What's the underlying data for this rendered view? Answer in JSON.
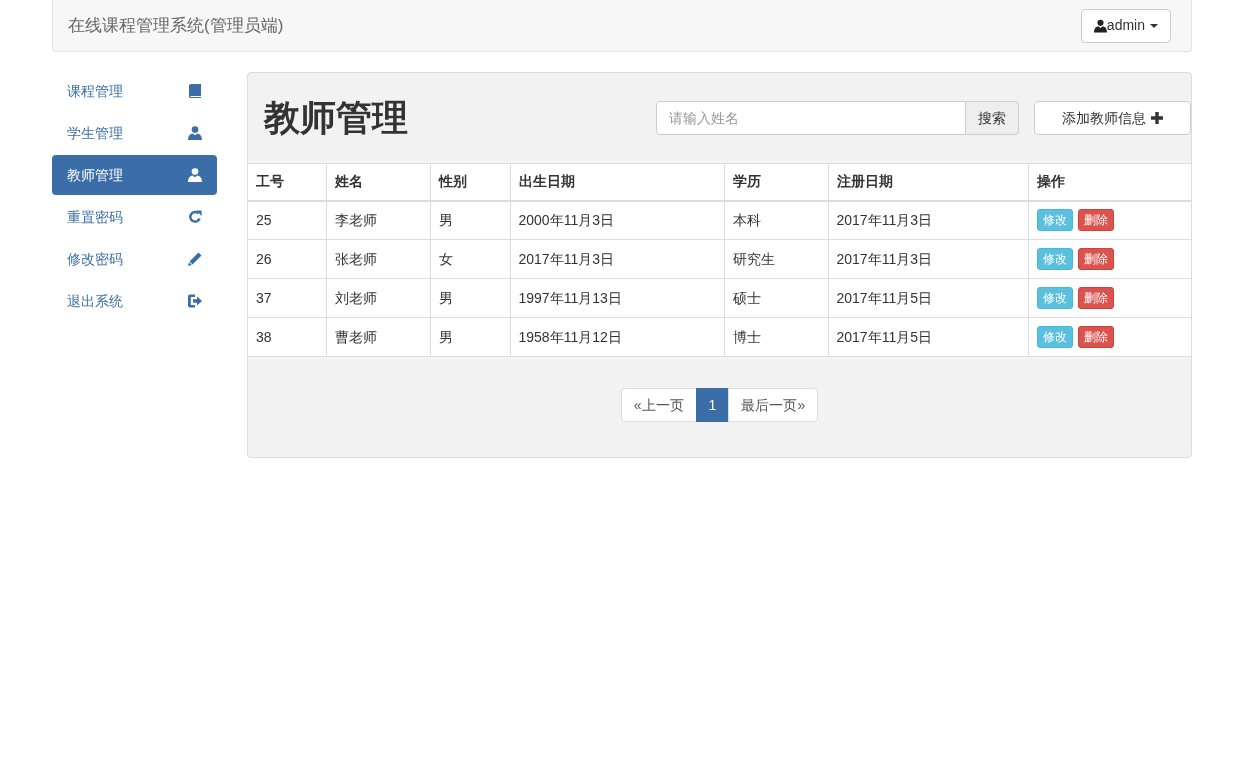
{
  "navbar": {
    "title": "在线课程管理系统(管理员端)",
    "user_menu": "admin"
  },
  "sidebar": {
    "items": [
      {
        "label": "课程管理",
        "selected": false
      },
      {
        "label": "学生管理",
        "selected": false
      },
      {
        "label": "教师管理",
        "selected": true
      },
      {
        "label": "重置密码",
        "selected": false
      },
      {
        "label": "修改密码",
        "selected": false
      },
      {
        "label": "退出系统",
        "selected": false
      }
    ]
  },
  "main": {
    "page_title": "教师管理",
    "search": {
      "placeholder": "请输入姓名",
      "button": "搜索"
    },
    "add_button": "添加教师信息",
    "table": {
      "columns": [
        "工号",
        "姓名",
        "性别",
        "出生日期",
        "学历",
        "注册日期",
        "操作"
      ],
      "rows": [
        {
          "cells": [
            "25",
            "李老师",
            "男",
            "2000年11月3日",
            "本科",
            "2017年11月3日"
          ],
          "actions": [
            {
              "label": "修改",
              "kind": "edit"
            },
            {
              "label": "删除",
              "kind": "delete"
            }
          ]
        },
        {
          "cells": [
            "26",
            "张老师",
            "女",
            "2017年11月3日",
            "研究生",
            "2017年11月3日"
          ],
          "actions": [
            {
              "label": "修改",
              "kind": "edit"
            },
            {
              "label": "删除",
              "kind": "delete"
            }
          ]
        },
        {
          "cells": [
            "37",
            "刘老师",
            "男",
            "1997年11月13日",
            "硕士",
            "2017年11月5日"
          ],
          "actions": [
            {
              "label": "修改",
              "kind": "edit"
            },
            {
              "label": "删除",
              "kind": "delete"
            }
          ]
        },
        {
          "cells": [
            "38",
            "曹老师",
            "男",
            "1958年11月12日",
            "博士",
            "2017年11月5日"
          ],
          "actions": [
            {
              "label": "修改",
              "kind": "edit"
            },
            {
              "label": "删除",
              "kind": "delete"
            }
          ]
        }
      ]
    },
    "pagination": [
      {
        "label": "«上一页",
        "selected": false
      },
      {
        "label": "1",
        "selected": true
      },
      {
        "label": "最后一页»",
        "selected": false
      }
    ]
  }
}
